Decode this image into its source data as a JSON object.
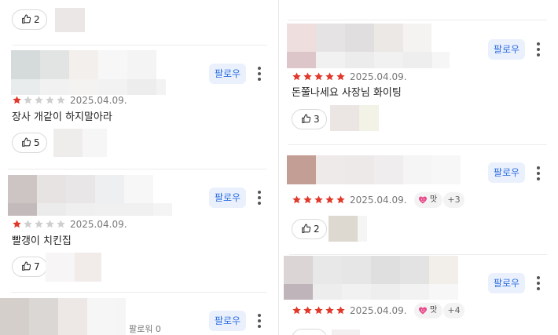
{
  "follow_label": "팔로우",
  "left_reviews": [
    {
      "likes": "2"
    },
    {
      "rating": 1,
      "date": "2025.04.09.",
      "text": "장사 개같이 하지말아라",
      "likes": "5"
    },
    {
      "rating": 1,
      "date": "2025.04.09.",
      "text": "빨갱이 치킨집",
      "likes": "7"
    },
    {
      "followers": "팔로워 0"
    }
  ],
  "right_reviews": [
    {
      "rating": 5,
      "date": "2025.04.09.",
      "text": "돈쭐나세요 사장님 화이팅",
      "likes": "3"
    },
    {
      "rating": 5,
      "date": "2025.04.09.",
      "tag": "맛",
      "tag_more": "+3",
      "likes": "2"
    },
    {
      "rating": 5,
      "date": "2025.04.09.",
      "tag": "맛",
      "tag_more": "+4"
    }
  ],
  "icons": {
    "like": "thumbs-up-icon",
    "more": "kebab-menu-icon",
    "star": "star-icon",
    "tag": "heart-face-icon"
  },
  "colors": {
    "star_filled": "#e0392b",
    "star_empty": "#cfcfcf",
    "follow_text": "#2f6fe0",
    "follow_bg": "#eaf1fd"
  }
}
